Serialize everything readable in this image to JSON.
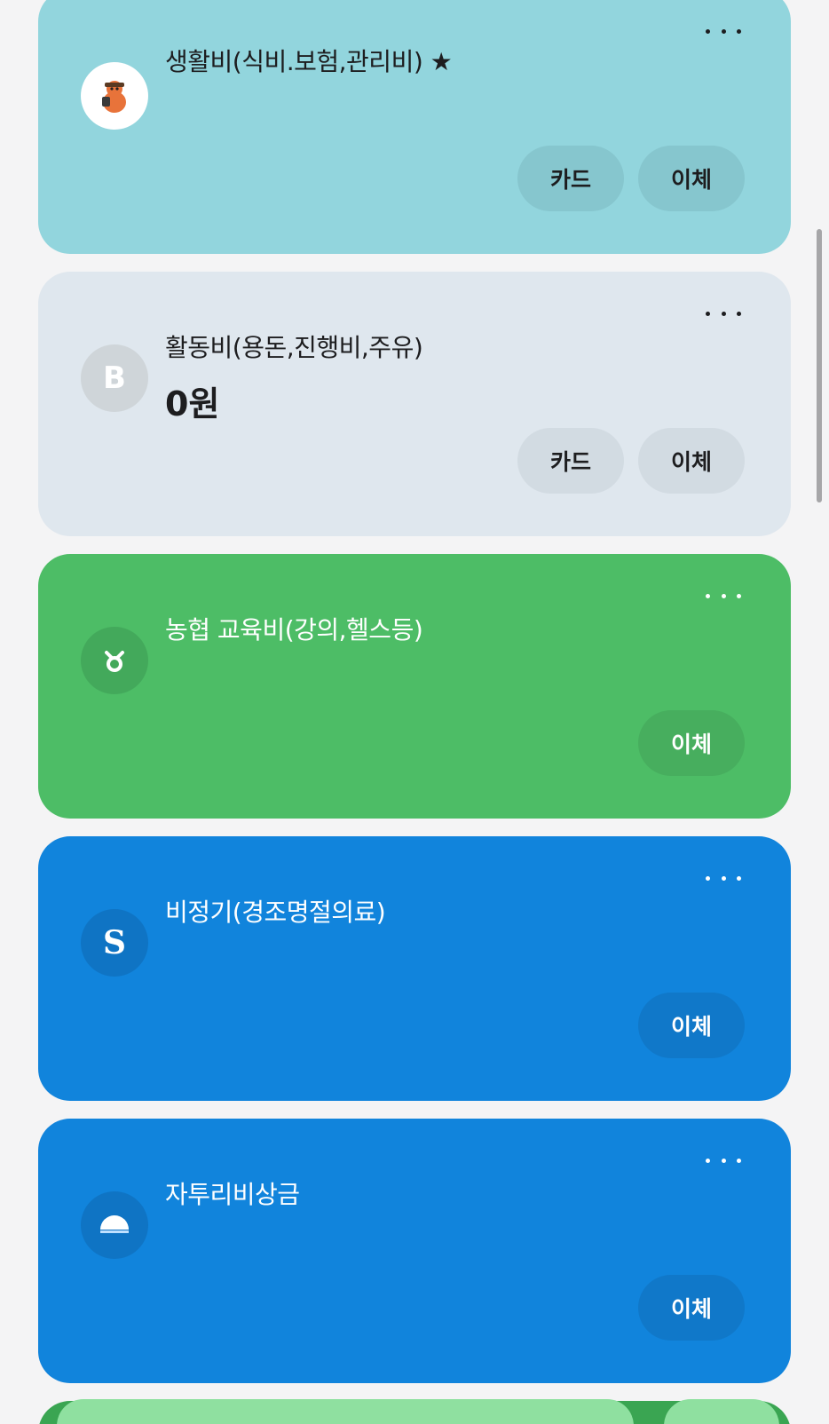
{
  "accounts": [
    {
      "title": "생활비(식비.보험,관리비) ★",
      "amount": "",
      "buttons": [
        "카드",
        "이체"
      ],
      "icon": "bank-character-icon",
      "color": "#92d5dd"
    },
    {
      "title": "활동비(용돈,진행비,주유)",
      "amount": "0원",
      "buttons": [
        "카드",
        "이체"
      ],
      "icon": "bank-b-icon",
      "color": "#dfe7ee"
    },
    {
      "title": "농협 교육비(강의,헬스등)",
      "amount": "",
      "buttons": [
        "이체"
      ],
      "icon": "nonghyup-icon",
      "color": "#4dbd66"
    },
    {
      "title": "비정기(경조명절의료)",
      "amount": "",
      "buttons": [
        "이체"
      ],
      "icon": "shinhan-icon",
      "color": "#1184dc"
    },
    {
      "title": "자투리비상금",
      "amount": "",
      "buttons": [
        "이체"
      ],
      "icon": "bank-dome-icon",
      "color": "#1184dc"
    }
  ]
}
